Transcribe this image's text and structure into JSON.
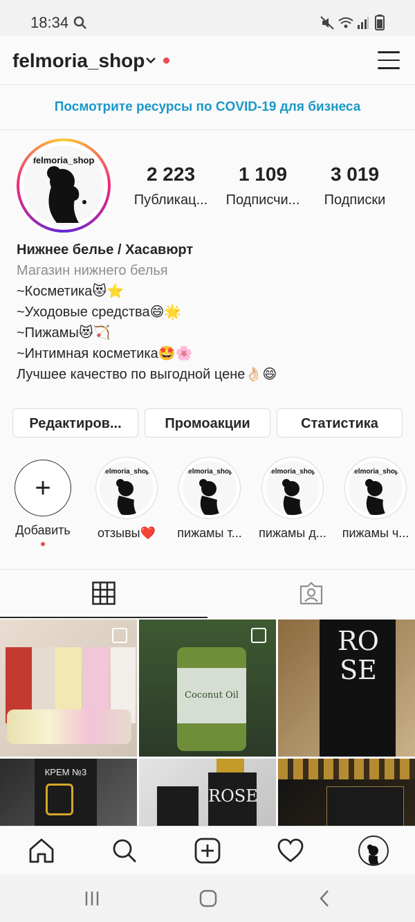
{
  "status_bar": {
    "time": "18:34",
    "icons": [
      "search-icon",
      "mute-icon",
      "wifi-icon",
      "signal-icon",
      "battery-icon"
    ]
  },
  "header": {
    "username": "felmoria_shop"
  },
  "banner": {
    "text": "Посмотрите ресурсы по COVID-19 для бизнеса"
  },
  "profile": {
    "avatar_label": "felmoria_shop",
    "stats": [
      {
        "value": "2 223",
        "label": "Публикац..."
      },
      {
        "value": "1 109",
        "label": "Подписчи..."
      },
      {
        "value": "3 019",
        "label": "Подписки"
      }
    ],
    "bio": {
      "name": "Нижнее белье / Хасавюрт",
      "category": "Магазин нижнего белья",
      "lines": [
        "~Косметика😻⭐",
        "~Уходовые средства😄🌟",
        "~Пижамы😻🏹",
        "~Интимная косметика🤩🌸",
        "Лучшее качество по выгодной цене👌🏻😄"
      ]
    }
  },
  "buttons": {
    "edit": "Редактиров...",
    "promo": "Промоакции",
    "stats": "Статистика"
  },
  "highlights": [
    {
      "label": "Добавить",
      "kind": "add"
    },
    {
      "label": "отзывы❤️",
      "mini": "felmoria_shop"
    },
    {
      "label": "пижамы т...",
      "mini": "felmoria_shop"
    },
    {
      "label": "пижамы д...",
      "mini": "felmoria_shop"
    },
    {
      "label": "пижамы ч...",
      "mini": "felmoria_shop"
    }
  ],
  "tabs": [
    "grid-icon",
    "tagged-icon"
  ],
  "posts": [
    {
      "caption": "",
      "colors": [
        "#d9cfc2",
        "#c43a2f",
        "#f0d6e0"
      ]
    },
    {
      "caption": "Coconut Oil",
      "colors": [
        "#2f4a2a",
        "#6f8e3a",
        "#e9ecef"
      ]
    },
    {
      "caption": "ROSE",
      "colors": [
        "#111111",
        "#8b6b3e",
        "#c9b18a"
      ]
    },
    {
      "caption": "КРЕМ №3",
      "colors": [
        "#1b1b1b",
        "#d4a72c",
        "#6e6e6e"
      ]
    },
    {
      "caption": "ROSE",
      "colors": [
        "#1b1b1b",
        "#c49a2b",
        "#e4e4e4"
      ]
    },
    {
      "caption": "",
      "colors": [
        "#121212",
        "#b58b32",
        "#9c7a40"
      ]
    }
  ],
  "nav": [
    "home-icon",
    "search-icon",
    "new-post-icon",
    "activity-heart-icon",
    "profile-avatar"
  ],
  "sysnav": [
    "recent-apps-icon",
    "home-button-icon",
    "back-icon"
  ],
  "colors": {
    "accent": "#1a98c9",
    "notify": "#ed4956",
    "text": "#262626",
    "muted": "#8e8e8e"
  }
}
